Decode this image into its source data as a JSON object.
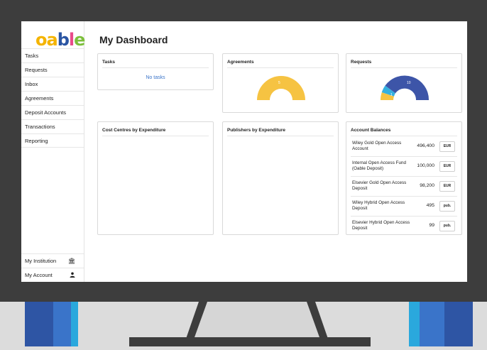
{
  "app": {
    "logo_text": "oable",
    "logo_colors": [
      "#f4b400",
      "#2a55a3",
      "#5ab4e5",
      "#e94b8a",
      "#7cbf3b"
    ]
  },
  "page_title": "My Dashboard",
  "sidebar": {
    "items": [
      {
        "label": "Tasks"
      },
      {
        "label": "Requests"
      },
      {
        "label": "Inbox"
      },
      {
        "label": "Agreements"
      },
      {
        "label": "Deposit Accounts"
      },
      {
        "label": "Transactions"
      },
      {
        "label": "Reporting"
      }
    ],
    "bottom": [
      {
        "label": "My Institution",
        "icon": "institution-icon"
      },
      {
        "label": "My Account",
        "icon": "user-icon"
      }
    ]
  },
  "cards": {
    "tasks": {
      "title": "Tasks",
      "empty_text": "No tasks"
    },
    "agreements": {
      "title": "Agreements",
      "segment_label": "5"
    },
    "requests": {
      "title": "Requests",
      "segment_labels": [
        "1",
        "10"
      ]
    },
    "cost_centres": {
      "title": "Cost Centres by Expenditure"
    },
    "publishers": {
      "title": "Publishers by Expenditure"
    },
    "balances": {
      "title": "Account Balances",
      "rows": [
        {
          "name": "Wiley Gold Open Access Account",
          "amount": "496,400",
          "unit": "EUR"
        },
        {
          "name": "Internal Open Access Fund (Oable Deposit)",
          "amount": "100,000",
          "unit": "EUR"
        },
        {
          "name": "Elsevier Gold Open Access Deposit",
          "amount": "98,200",
          "unit": "EUR"
        },
        {
          "name": "Wiley Hybrid Open Access Deposit",
          "amount": "495",
          "unit": "pub."
        },
        {
          "name": "Elsevier Hybrid Open Access Deposit",
          "amount": "99",
          "unit": "pub."
        }
      ]
    }
  },
  "colors": {
    "agreements_gauge": "#f6c342",
    "requests_main": "#3d55a8",
    "requests_secondary": "#35b0df",
    "requests_tertiary": "#f6c342",
    "link": "#3a74c9"
  }
}
